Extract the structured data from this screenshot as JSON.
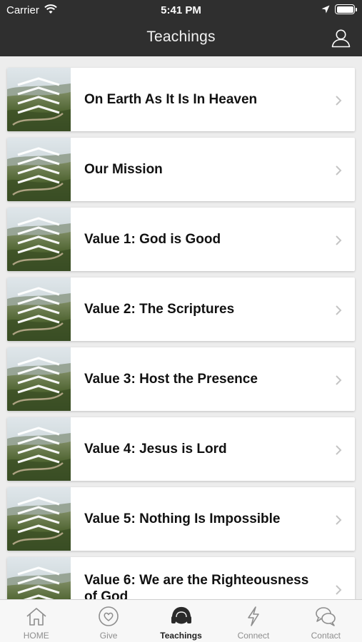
{
  "status_bar": {
    "carrier": "Carrier",
    "time": "5:41 PM"
  },
  "nav": {
    "title": "Teachings",
    "profile_icon": "person-outline-icon"
  },
  "teachings": [
    {
      "title": "On Earth As It Is In Heaven"
    },
    {
      "title": "Our Mission"
    },
    {
      "title": "Value 1: God is Good"
    },
    {
      "title": "Value 2: The Scriptures"
    },
    {
      "title": "Value 3: Host the Presence"
    },
    {
      "title": "Value 4: Jesus is Lord"
    },
    {
      "title": "Value 5: Nothing Is Impossible"
    },
    {
      "title": "Value 6: We are the Righteousness of God"
    }
  ],
  "tabs": [
    {
      "label": "HOME",
      "icon": "home-icon",
      "active": false
    },
    {
      "label": "Give",
      "icon": "heart-icon",
      "active": false
    },
    {
      "label": "Teachings",
      "icon": "headphones-icon",
      "active": true
    },
    {
      "label": "Connect",
      "icon": "lightning-icon",
      "active": false
    },
    {
      "label": "Contact",
      "icon": "chat-bubbles-icon",
      "active": false
    }
  ],
  "colors": {
    "header_bg": "#2f2f2f",
    "list_bg": "#ededed",
    "tab_active": "#222222",
    "tab_inactive": "#8e8e8e"
  }
}
